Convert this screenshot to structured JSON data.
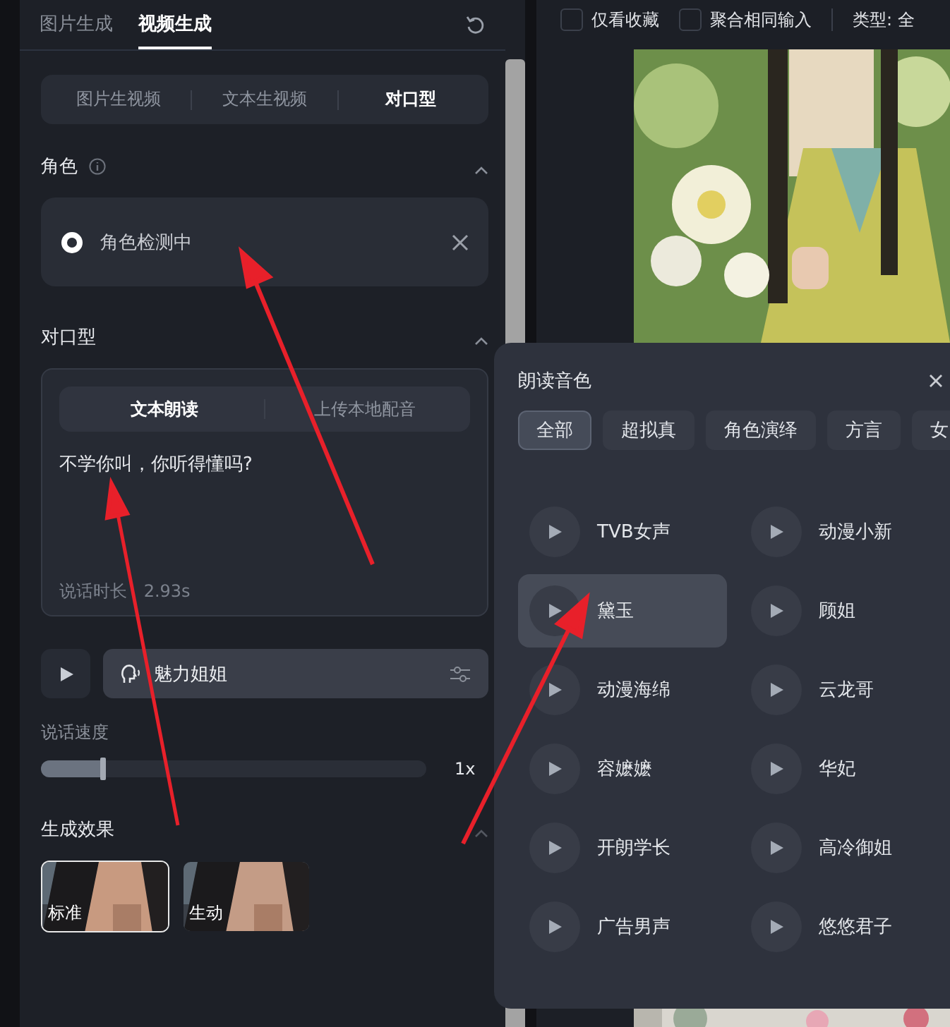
{
  "left_panel": {
    "tabs": [
      {
        "label": "图片生成",
        "selected": false
      },
      {
        "label": "视频生成",
        "selected": true
      }
    ],
    "mode_tabs": [
      {
        "label": "图片生视频",
        "selected": false
      },
      {
        "label": "文本生视频",
        "selected": false
      },
      {
        "label": "对口型",
        "selected": true
      }
    ],
    "role_section": {
      "title": "角色",
      "expanded": true,
      "status": "角色检测中"
    },
    "lipsync_section": {
      "title": "对口型",
      "expanded": true,
      "source_tabs": [
        {
          "label": "文本朗读",
          "selected": true
        },
        {
          "label": "上传本地配音",
          "selected": false
        }
      ],
      "text": "不学你叫，你听得懂吗?",
      "duration": "说话时长 2.93s",
      "voice": "魅力姐姐"
    },
    "speed": {
      "label": "说话速度",
      "level": 0.16,
      "reading": "1x"
    },
    "effect": {
      "title": "生成效果",
      "expanded": true,
      "options": [
        {
          "label": "标准",
          "selected": true
        },
        {
          "label": "生动",
          "selected": false
        }
      ]
    }
  },
  "toolbar": {
    "filters": [
      {
        "label": "仅看收藏",
        "checked": false
      },
      {
        "label": "聚合相同输入",
        "checked": false
      }
    ],
    "type_label": "类型: 全"
  },
  "voice_popup": {
    "title": "朗读音色",
    "categories": [
      {
        "label": "全部",
        "selected": true
      },
      {
        "label": "超拟真",
        "selected": false
      },
      {
        "label": "角色演绎",
        "selected": false
      },
      {
        "label": "方言",
        "selected": false
      },
      {
        "label": "女",
        "selected": false
      }
    ],
    "voices": [
      {
        "name": "TVB女声",
        "selected": false
      },
      {
        "name": "动漫小新",
        "selected": false
      },
      {
        "name": "黛玉",
        "selected": true
      },
      {
        "name": "顾姐",
        "selected": false
      },
      {
        "name": "动漫海绵",
        "selected": false
      },
      {
        "name": "云龙哥",
        "selected": false
      },
      {
        "name": "容嬷嬷",
        "selected": false
      },
      {
        "name": "华妃",
        "selected": false
      },
      {
        "name": "开朗学长",
        "selected": false
      },
      {
        "name": "高冷御姐",
        "selected": false
      },
      {
        "name": "广告男声",
        "selected": false
      },
      {
        "name": "悠悠君子",
        "selected": false
      }
    ]
  }
}
